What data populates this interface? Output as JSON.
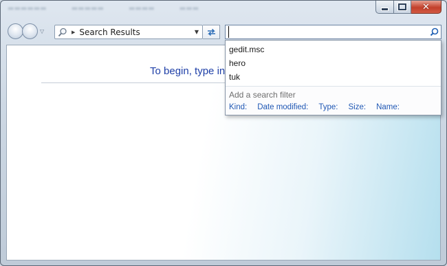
{
  "address_bar": {
    "location": "Search Results"
  },
  "search": {
    "value": "",
    "placeholder": ""
  },
  "content": {
    "prompt_text": "To begin, type in"
  },
  "suggestions": {
    "history": [
      {
        "label": "gedit.msc"
      },
      {
        "label": "hero"
      },
      {
        "label": "tuk"
      }
    ],
    "filter_heading": "Add a search filter",
    "filters": [
      {
        "label": "Kind:"
      },
      {
        "label": "Date modified:"
      },
      {
        "label": "Type:"
      },
      {
        "label": "Size:"
      },
      {
        "label": "Name:"
      }
    ]
  },
  "colors": {
    "accent": "#1e3fa7",
    "link": "#1f57b4",
    "close_button": "#c2402b"
  }
}
